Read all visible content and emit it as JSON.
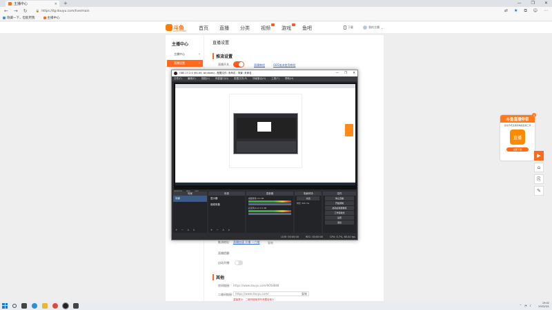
{
  "browser": {
    "tab_title": "主播中心",
    "new_tab": "+",
    "url": "https://tg.douyu.com/live/main",
    "window_controls": [
      "—",
      "❐",
      "✕"
    ],
    "bookmarks": [
      "隐藏一下，但能用我",
      "主播中心"
    ]
  },
  "site": {
    "logo_text": "斗鱼",
    "logo_sub": "DOUYU.COM",
    "nav": [
      "首页",
      "直播",
      "分类",
      "视频",
      "游戏",
      "鱼吧"
    ],
    "header_right": [
      "下载",
      "我的主播"
    ]
  },
  "sidebar": {
    "title": "主播中心",
    "items": [
      {
        "label": "主播中心",
        "chevron": "›"
      },
      {
        "label": "直播设置",
        "chevron": "›"
      }
    ]
  },
  "main": {
    "page_title": "直播设置",
    "section_title": "推流设置",
    "live_switch_label": "直播开关",
    "link1": "直播教程",
    "link2": "OBS推流使用教程",
    "row_label_a": "推流地址:",
    "link_a": "直播加速 开播 一六推",
    "gray_a": "复制",
    "row_label_b": "直播提醒:",
    "row_label_c": "自动开播:",
    "other_title": "其他",
    "room_label": "房间链接:",
    "room_value": "https://www.douyu.com/9058888",
    "qr_label": "二维码链接:",
    "qr_placeholder": "https://www.douyu.com/",
    "qr_select": "复制",
    "warn": "温馨提示：二维码链接请勿泄露给他人"
  },
  "obs": {
    "title": "OBS 27.2.4 (64-bit, windows) - 配置文件: 未命名 - 场景: 未命名",
    "menu": [
      "文件(F)",
      "编辑(E)",
      "视图(V)",
      "停靠窗口(D)",
      "配置文件(P)",
      "场景集合(S)",
      "工具(T)",
      "帮助(H)"
    ],
    "scene_tabs": [
      "场景转场",
      "属性",
      "滤镜"
    ],
    "docks": {
      "scenes": {
        "title": "场景",
        "items": [
          "场景"
        ]
      },
      "sources": {
        "title": "来源",
        "items": [
          "显示器",
          "音频采集"
        ]
      },
      "mixer": {
        "title": "混音器",
        "tracks": [
          {
            "name": "桌面音频",
            "level": "0.0 dB"
          },
          {
            "name": "麦克风/Aux",
            "level": "0.0 dB"
          }
        ]
      },
      "transitions": {
        "title": "场景转场",
        "mode": "淡出",
        "duration_label": "时长",
        "duration": "300 ms"
      },
      "controls": {
        "title": "控件",
        "buttons": [
          "停止直播",
          "开始录制",
          "启动虚拟摄像机",
          "工作室模式",
          "设置",
          "退出"
        ]
      }
    },
    "footer_symbols": "+ − ∧ ∨",
    "status": [
      "LIVE: 00:00:00",
      "REC: 00:00:00",
      "CPU: 0.7%, 60.00 fps"
    ]
  },
  "promo": {
    "title": "斗鱼直播伴侣",
    "subtitle": "适合手机直播和电脑直播工具",
    "icon_label": "直播",
    "button": "立即下载",
    "close": "×"
  },
  "float_buttons": [
    "▶",
    "⌂",
    "⎘",
    "✎"
  ],
  "taskbar": {
    "time": "19:02",
    "date": "2022/3/1"
  },
  "colors": {
    "brand": "#ff6a1f",
    "obs_bg": "#2b2d31",
    "link": "#2f6fd6"
  }
}
